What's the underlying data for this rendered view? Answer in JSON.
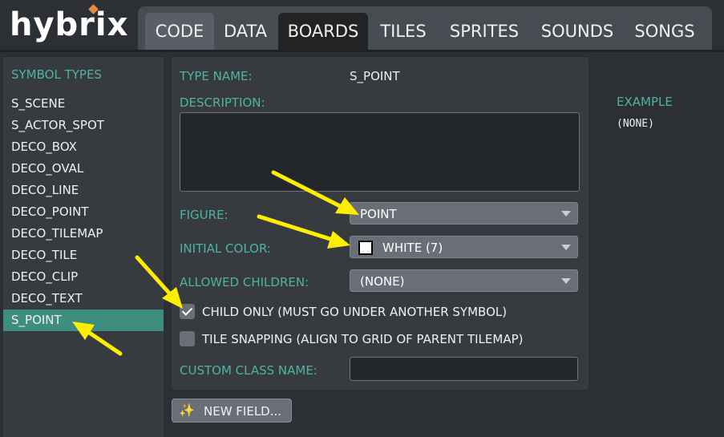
{
  "app": {
    "logo_text": "hybrix"
  },
  "tabs": [
    {
      "label": "CODE"
    },
    {
      "label": "DATA"
    },
    {
      "label": "BOARDS",
      "active": true
    },
    {
      "label": "TILES"
    },
    {
      "label": "SPRITES"
    },
    {
      "label": "SOUNDS"
    },
    {
      "label": "SONGS"
    }
  ],
  "sidebar": {
    "heading": "SYMBOL TYPES",
    "items": [
      {
        "label": "S_SCENE"
      },
      {
        "label": "S_ACTOR_SPOT"
      },
      {
        "label": "DECO_BOX"
      },
      {
        "label": "DECO_OVAL"
      },
      {
        "label": "DECO_LINE"
      },
      {
        "label": "DECO_POINT"
      },
      {
        "label": "DECO_TILEMAP"
      },
      {
        "label": "DECO_TILE"
      },
      {
        "label": "DECO_CLIP"
      },
      {
        "label": "DECO_TEXT"
      },
      {
        "label": "S_POINT",
        "selected": true
      }
    ]
  },
  "form": {
    "type_name_label": "TYPE NAME:",
    "type_name_value": "S_POINT",
    "description_label": "DESCRIPTION:",
    "description_value": "",
    "figure_label": "FIGURE:",
    "figure_value": "POINT",
    "initial_color_label": "INITIAL COLOR:",
    "initial_color_value": "WHITE (7)",
    "initial_color_swatch": "#ffffff",
    "allowed_children_label": "ALLOWED CHILDREN:",
    "allowed_children_value": "(NONE)",
    "child_only_label": "CHILD ONLY (MUST GO UNDER ANOTHER SYMBOL)",
    "child_only_checked": true,
    "tile_snapping_label": "TILE SNAPPING (ALIGN TO GRID OF PARENT TILEMAP)",
    "tile_snapping_checked": false,
    "custom_class_label": "CUSTOM CLASS NAME:",
    "custom_class_value": ""
  },
  "new_field_button": {
    "label": "NEW FIELD...",
    "icon": "sparkles-icon"
  },
  "example": {
    "label": "EXAMPLE",
    "value": "(NONE)"
  },
  "colors": {
    "accent": "#4fb3a2",
    "selected": "#3d8e80",
    "annotation_arrow": "#ffee00"
  }
}
